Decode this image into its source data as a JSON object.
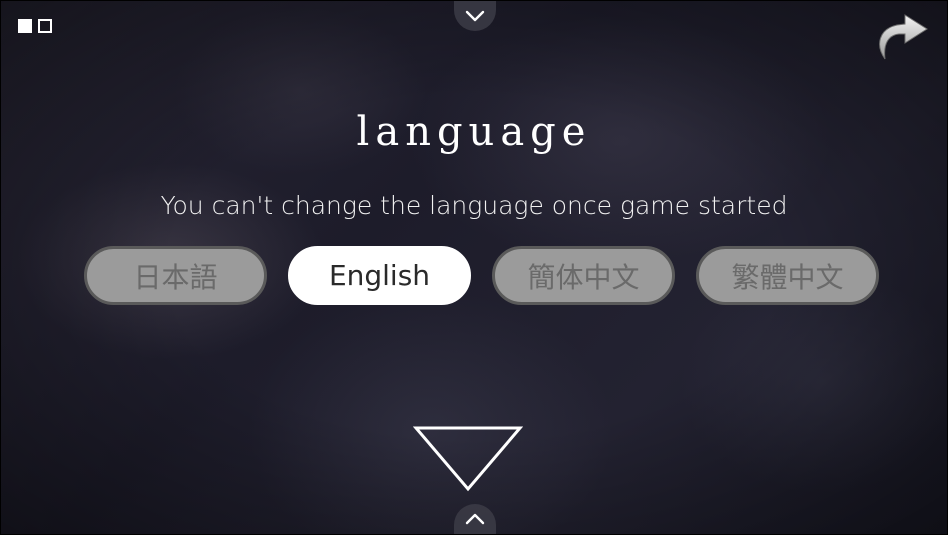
{
  "page_indicator": {
    "total": 2,
    "current": 1
  },
  "icons": {
    "top_tab": "chevron-down-icon",
    "bottom_tab": "chevron-up-icon",
    "back": "curved-arrow-back-icon",
    "next": "triangle-down-icon"
  },
  "screen": {
    "title": "language",
    "notice": "You can't change the language once game started"
  },
  "languages": {
    "selected": "English",
    "options": [
      {
        "label": "日本語"
      },
      {
        "label": "English"
      },
      {
        "label": "簡体中文"
      },
      {
        "label": "繁體中文"
      }
    ]
  }
}
